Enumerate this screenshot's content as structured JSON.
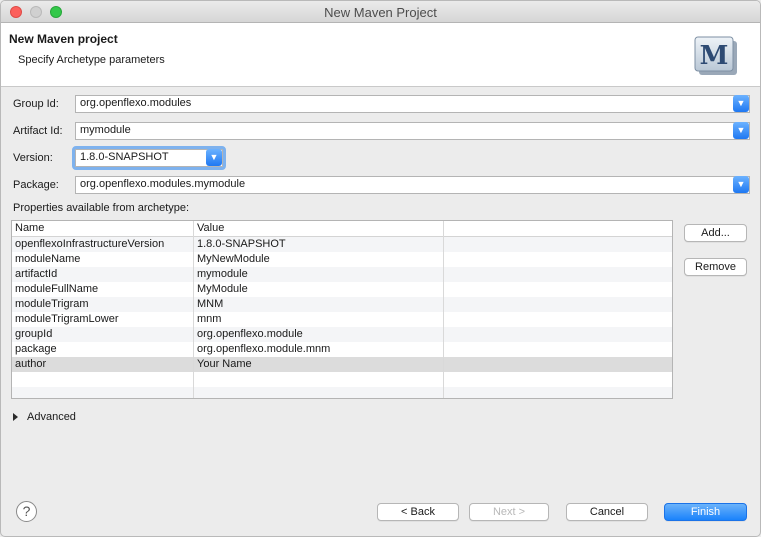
{
  "window": {
    "title": "New Maven Project"
  },
  "header": {
    "title": "New Maven project",
    "subtitle": "Specify Archetype parameters",
    "logo_icon": "maven-logo-icon",
    "logo_letter": "M"
  },
  "form": {
    "group_id": {
      "label": "Group Id:",
      "value": "org.openflexo.modules"
    },
    "artifact_id": {
      "label": "Artifact Id:",
      "value": "mymodule"
    },
    "version": {
      "label": "Version:",
      "value": "1.8.0-SNAPSHOT"
    },
    "package": {
      "label": "Package:",
      "value": "org.openflexo.modules.mymodule"
    }
  },
  "properties": {
    "label": "Properties available from archetype:",
    "columns": [
      "Name",
      "Value"
    ],
    "rows": [
      {
        "name": "openflexoInfrastructureVersion",
        "value": "1.8.0-SNAPSHOT"
      },
      {
        "name": "moduleName",
        "value": "MyNewModule"
      },
      {
        "name": "artifactId",
        "value": "mymodule"
      },
      {
        "name": "moduleFullName",
        "value": "MyModule"
      },
      {
        "name": "moduleTrigram",
        "value": "MNM"
      },
      {
        "name": "moduleTrigramLower",
        "value": "mnm"
      },
      {
        "name": "groupId",
        "value": "org.openflexo.module"
      },
      {
        "name": "package",
        "value": "org.openflexo.module.mnm"
      },
      {
        "name": "author",
        "value": "Your Name"
      }
    ],
    "add_label": "Add...",
    "remove_label": "Remove"
  },
  "advanced": {
    "label": "Advanced"
  },
  "footer": {
    "help": "?",
    "back": "< Back",
    "next": "Next >",
    "cancel": "Cancel",
    "finish": "Finish"
  },
  "colors": {
    "accent": "#1a82fb",
    "selected_row": "#dcdcdc"
  }
}
